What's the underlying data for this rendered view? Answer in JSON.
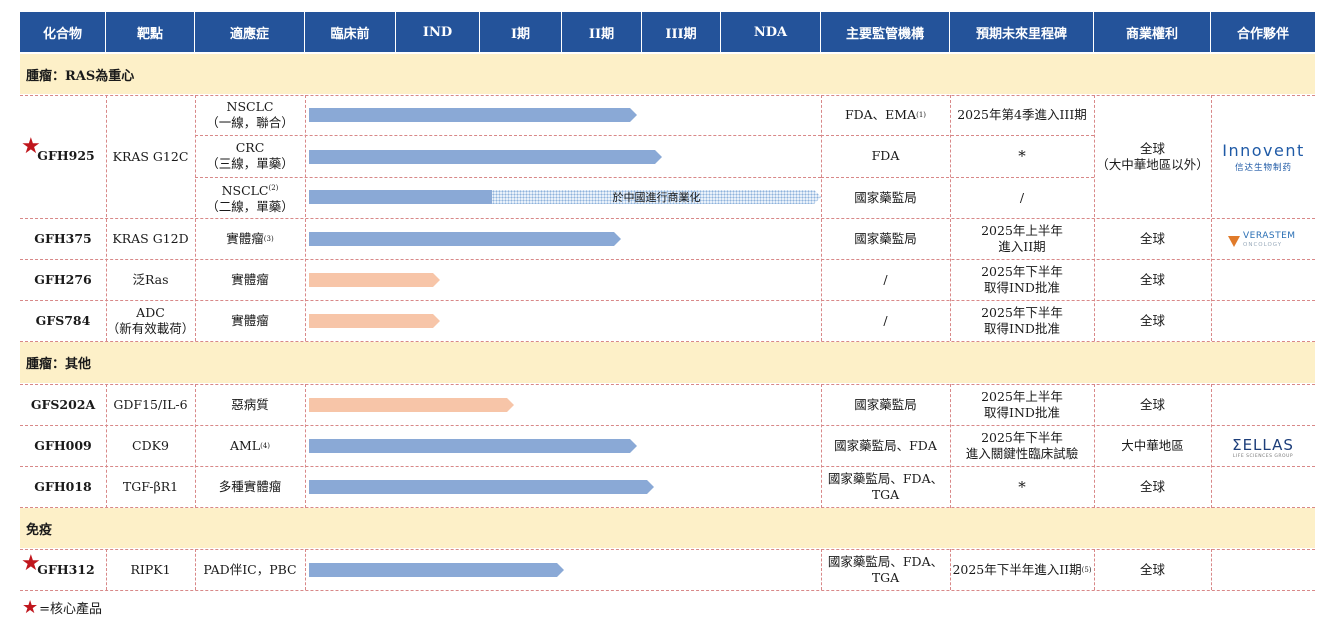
{
  "headers": [
    "化合物",
    "靶點",
    "適應症",
    "臨床前",
    "IND",
    "I期",
    "II期",
    "III期",
    "NDA",
    "主要監管機構",
    "預期未來里程碑",
    "商業權利",
    "合作夥伴"
  ],
  "sections": {
    "ras": "腫瘤：RAS為重心",
    "other": "腫瘤：其他",
    "immune": "免疫"
  },
  "rows": {
    "gfh925": {
      "compound": "GFH925",
      "target": "KRAS G12C",
      "indications": [
        {
          "line1": "NSCLC",
          "line2": "（一線，聯合）",
          "agency": "FDA、EMA",
          "agency_sup": "(1)",
          "milestone": "2025年第4季進入III期",
          "progress": 0.4
        },
        {
          "line1": "CRC",
          "line2": "（三線，單藥）",
          "agency": "FDA",
          "milestone": "*",
          "progress": 0.43
        },
        {
          "line1": "NSCLC",
          "line1_sup": "(2)",
          "line2": "（二線，單藥）",
          "agency": "國家藥監局",
          "milestone": "/",
          "progress": 0.35,
          "commercial_note": "於中國進行商業化"
        }
      ],
      "rights": "全球\n（大中華地區以外）",
      "partner": {
        "name": "Innovent",
        "sub": "信达生物制药",
        "icon": "innovent-logo"
      }
    },
    "gfh375": {
      "compound": "GFH375",
      "target": "KRAS G12D",
      "indication": "實體瘤",
      "indication_sup": "(3)",
      "agency": "國家藥監局",
      "milestone": "2025年上半年\n進入II期",
      "rights": "全球",
      "partner": {
        "name": "VERASTEM",
        "sub": "ONCOLOGY",
        "icon": "verastem-logo"
      },
      "progress": 0.38
    },
    "gfh276": {
      "compound": "GFH276",
      "target": "泛Ras",
      "indication": "實體瘤",
      "agency": "/",
      "milestone": "2025年下半年\n取得IND批准",
      "rights": "全球",
      "progress": 0.16
    },
    "gfs784": {
      "compound": "GFS784",
      "target": "ADC\n（新有效載荷）",
      "indication": "實體瘤",
      "agency": "/",
      "milestone": "2025年下半年\n取得IND批准",
      "rights": "全球",
      "progress": 0.16
    },
    "gfs202a": {
      "compound": "GFS202A",
      "target": "GDF15/IL-6",
      "indication": "惡病質",
      "agency": "國家藥監局",
      "milestone": "2025年上半年\n取得IND批准",
      "rights": "全球",
      "progress": 0.25
    },
    "gfh009": {
      "compound": "GFH009",
      "target": "CDK9",
      "indication": "AML",
      "indication_sup": "(4)",
      "agency": "國家藥監局、FDA",
      "milestone": "2025年下半年\n進入關鍵性臨床試驗",
      "rights": "大中華地區",
      "partner": {
        "name": "ΣELLAS",
        "sub": "LIFE SCIENCES GROUP",
        "icon": "sellas-logo"
      },
      "progress": 0.4
    },
    "gfh018": {
      "compound": "GFH018",
      "target": "TGF-βR1",
      "indication": "多種實體瘤",
      "agency": "國家藥監局、FDA、\nTGA",
      "milestone": "*",
      "rights": "全球",
      "progress": 0.42
    },
    "gfh312": {
      "compound": "GFH312",
      "target": "RIPK1",
      "indication": "PAD伴IC，PBC",
      "agency": "國家藥監局、FDA、\nTGA",
      "milestone": "2025年下半年進入II期",
      "milestone_sup": "(5)",
      "rights": "全球",
      "progress": 0.31
    }
  },
  "legend": "=核心產品",
  "colors": {
    "header_bg": "#24539a",
    "section_bg": "#fdf0c8",
    "bar_blue": "#8aa9d6",
    "bar_orange": "#f7c5a8",
    "star": "#c0161d",
    "divider": "#d88888"
  }
}
